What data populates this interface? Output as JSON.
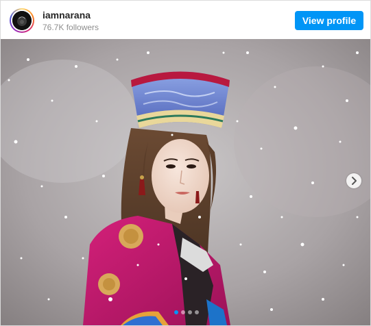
{
  "profile": {
    "username": "iamnarana",
    "followers": "76.7K followers",
    "view_profile_label": "View profile"
  },
  "post": {
    "carousel_count": 4,
    "active_index": 0,
    "next_icon": "chevron-right-icon"
  },
  "colors": {
    "accent": "#0095f6",
    "border": "#dbdbdb",
    "username_text": "#262626",
    "secondary_text": "#8e8e8e"
  }
}
